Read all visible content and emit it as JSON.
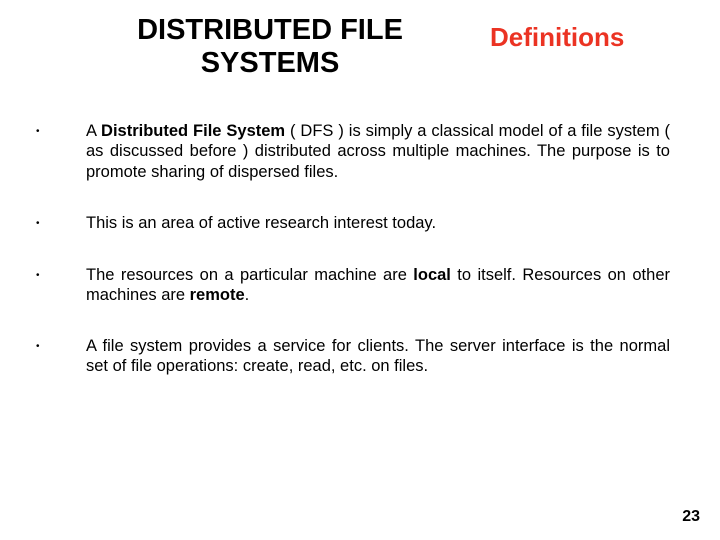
{
  "header": {
    "title_left": "DISTRIBUTED FILE SYSTEMS",
    "title_right": "Definitions"
  },
  "bullets": {
    "b1": {
      "seg1": "A ",
      "bold1": "Distributed File System",
      "seg2": " ( DFS ) is simply a classical model of a file system ( as discussed before ) distributed across multiple machines. The purpose is to promote sharing of dispersed files."
    },
    "b2": {
      "text": "This is an area of active research interest today."
    },
    "b3": {
      "seg1": "The resources on a particular machine are ",
      "bold1": "local",
      "seg2": " to itself.   Resources on other machines are ",
      "bold2": "remote",
      "seg3": "."
    },
    "b4": {
      "text": "A file system provides a service for clients. The server interface is the normal set of file operations: create, read, etc. on files."
    }
  },
  "page_number": "23",
  "dot": "•"
}
